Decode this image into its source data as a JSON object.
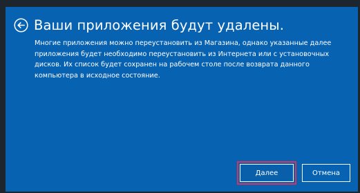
{
  "dialog": {
    "title": "Ваши приложения будут удалены.",
    "message": "Многие приложения можно переустановить из Магазина, однако указанные далее приложения будет необходимо переустановить из Интернета или с установочных дисков. Их список будет сохранен на рабочем столе после возврата данного компьютера в исходное состояние.",
    "back_icon": "arrow-left-circle-icon"
  },
  "buttons": {
    "next_label": "Далее",
    "cancel_label": "Отмена"
  },
  "colors": {
    "panel_background": "#0862b2",
    "text": "#ffffff",
    "highlight_outline": "#d4335d"
  }
}
